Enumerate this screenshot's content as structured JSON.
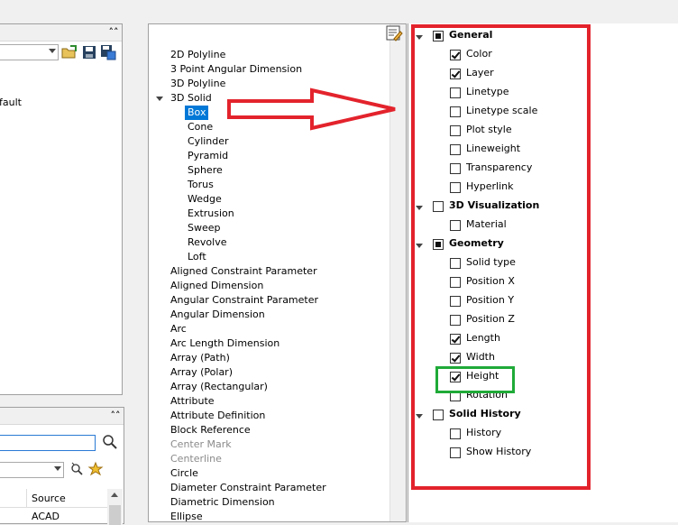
{
  "left_top_panel": {
    "collapse_icon": "double-chevron-up",
    "partial_text": "fault"
  },
  "left_bottom_panel": {
    "collapse_icon": "double-chevron-up",
    "search_icon": "magnifier",
    "column_header": "Source",
    "first_value": "ACAD"
  },
  "tree": {
    "items": [
      {
        "label": "2D Polyline",
        "level": 0
      },
      {
        "label": "3 Point Angular Dimension",
        "level": 0
      },
      {
        "label": "3D Polyline",
        "level": 0
      },
      {
        "label": "3D Solid",
        "level": 0,
        "expanded": true
      },
      {
        "label": "Box",
        "level": 1,
        "selected": true
      },
      {
        "label": "Cone",
        "level": 1
      },
      {
        "label": "Cylinder",
        "level": 1
      },
      {
        "label": "Pyramid",
        "level": 1
      },
      {
        "label": "Sphere",
        "level": 1
      },
      {
        "label": "Torus",
        "level": 1
      },
      {
        "label": "Wedge",
        "level": 1
      },
      {
        "label": "Extrusion",
        "level": 1
      },
      {
        "label": "Sweep",
        "level": 1
      },
      {
        "label": "Revolve",
        "level": 1
      },
      {
        "label": "Loft",
        "level": 1
      },
      {
        "label": "Aligned Constraint Parameter",
        "level": 0
      },
      {
        "label": "Aligned Dimension",
        "level": 0
      },
      {
        "label": "Angular Constraint Parameter",
        "level": 0
      },
      {
        "label": "Angular Dimension",
        "level": 0
      },
      {
        "label": "Arc",
        "level": 0
      },
      {
        "label": "Arc Length Dimension",
        "level": 0
      },
      {
        "label": "Array (Path)",
        "level": 0
      },
      {
        "label": "Array (Polar)",
        "level": 0
      },
      {
        "label": "Array (Rectangular)",
        "level": 0
      },
      {
        "label": "Attribute",
        "level": 0
      },
      {
        "label": "Attribute Definition",
        "level": 0
      },
      {
        "label": "Block Reference",
        "level": 0
      },
      {
        "label": "Center Mark",
        "level": 0,
        "disabled": true
      },
      {
        "label": "Centerline",
        "level": 0,
        "disabled": true
      },
      {
        "label": "Circle",
        "level": 0
      },
      {
        "label": "Diameter Constraint Parameter",
        "level": 0
      },
      {
        "label": "Diametric Dimension",
        "level": 0
      },
      {
        "label": "Ellipse",
        "level": 0
      }
    ]
  },
  "properties": {
    "groups": [
      {
        "label": "General",
        "state": "partial",
        "items": [
          {
            "label": "Color",
            "checked": true
          },
          {
            "label": "Layer",
            "checked": true
          },
          {
            "label": "Linetype",
            "checked": false
          },
          {
            "label": "Linetype scale",
            "checked": false
          },
          {
            "label": "Plot style",
            "checked": false
          },
          {
            "label": "Lineweight",
            "checked": false
          },
          {
            "label": "Transparency",
            "checked": false
          },
          {
            "label": "Hyperlink",
            "checked": false
          }
        ]
      },
      {
        "label": "3D Visualization",
        "state": "unchecked",
        "items": [
          {
            "label": "Material",
            "checked": false
          }
        ]
      },
      {
        "label": "Geometry",
        "state": "partial",
        "items": [
          {
            "label": "Solid type",
            "checked": false
          },
          {
            "label": "Position X",
            "checked": false
          },
          {
            "label": "Position Y",
            "checked": false
          },
          {
            "label": "Position Z",
            "checked": false
          },
          {
            "label": "Length",
            "checked": true
          },
          {
            "label": "Width",
            "checked": true
          },
          {
            "label": "Height",
            "checked": true,
            "highlighted": true
          },
          {
            "label": "Rotation",
            "checked": false
          }
        ]
      },
      {
        "label": "Solid History",
        "state": "unchecked",
        "items": [
          {
            "label": "History",
            "checked": false
          },
          {
            "label": "Show History",
            "checked": false
          }
        ]
      }
    ]
  },
  "annotations": {
    "red_color": "#e3232c",
    "green_color": "#1faa38"
  },
  "colors": {
    "selection": "#0078d7"
  }
}
